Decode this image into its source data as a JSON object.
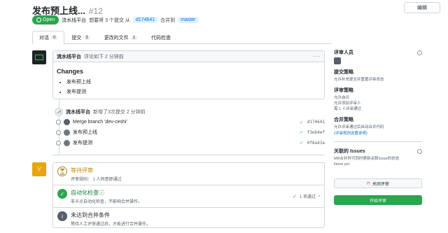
{
  "header": {
    "title": "发布预上线...",
    "number": "#12",
    "edit_label": "编辑",
    "status": "Open",
    "meta_user": "流水线平台",
    "meta_text": "想要将 3 个提交 从",
    "source_branch": "d174641",
    "meta_merge": "合并到",
    "target_branch": "master"
  },
  "tabs": [
    {
      "label": "对话",
      "count": "0"
    },
    {
      "label": "提交",
      "count": "3"
    },
    {
      "label": "更改的文件",
      "count": "1"
    },
    {
      "label": "代码检查",
      "count": ""
    }
  ],
  "comment": {
    "author": "流水线平台",
    "time": "评论如下 2 分钟前",
    "heading": "Changes",
    "items": [
      "发布预上线",
      "发布提测"
    ]
  },
  "event": {
    "author": "流水线平台",
    "text": "新增了3次提交 2 分钟前"
  },
  "commits": [
    {
      "message": "Merge branch 'dev-ceshi'",
      "sha": "d174641"
    },
    {
      "message": "发布预上线",
      "sha": "f3eb4ef"
    },
    {
      "message": "发布提测",
      "sha": "0f8a43a"
    }
  ],
  "merge": {
    "review": {
      "title": "等待评审",
      "desc": "评审规则：  1 人同意即通过"
    },
    "checks": {
      "title": "自动化检查ⓘ",
      "desc": "非卡点自动化检查，不影响合并操作。",
      "status": "1 项通过"
    },
    "conditions": {
      "title": "未达到合并条件",
      "desc": "等待人工评审通过后，才能进行合并操作。"
    }
  },
  "sidebar": {
    "reviewers_title": "评审人员",
    "commit_policy_title": "提交策略",
    "commit_policy_text": "允许补充提交并重置评审状态",
    "review_policy_title": "评审策略",
    "review_policy_lines": [
      "允许自评",
      "允许添加评审人",
      "需 1 人评审通过"
    ],
    "merge_policy_title": "合并策略",
    "merge_policy_text": "允许评审通过后自动合并代码",
    "merge_policy_link": "(评审规则设置说明)",
    "issues_title": "关联的 Issues",
    "issues_text": "MR合并时可同时更新关联Issue的状态",
    "issues_none": "None yet",
    "close_label": "关闭评审",
    "start_label": "开始评审"
  }
}
